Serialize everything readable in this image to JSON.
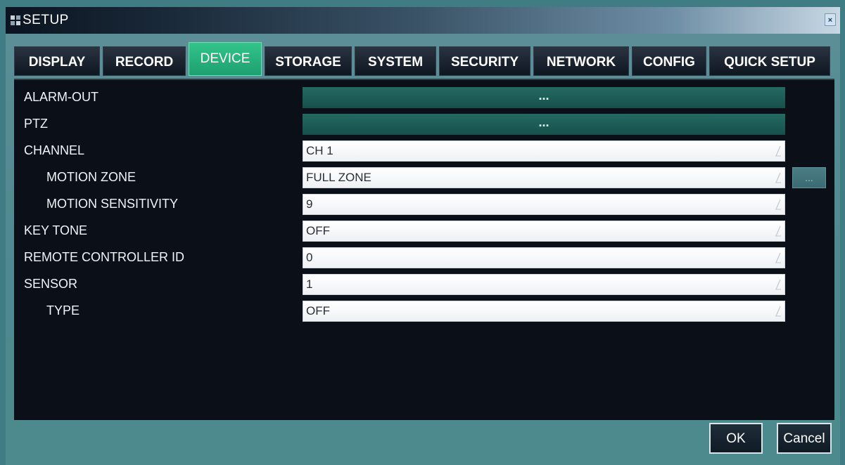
{
  "window": {
    "title": "SETUP",
    "close_label": "×"
  },
  "tabs": [
    {
      "label": "DISPLAY",
      "active": false
    },
    {
      "label": "RECORD",
      "active": false
    },
    {
      "label": "DEVICE",
      "active": true
    },
    {
      "label": "STORAGE",
      "active": false
    },
    {
      "label": "SYSTEM",
      "active": false
    },
    {
      "label": "SECURITY",
      "active": false
    },
    {
      "label": "NETWORK",
      "active": false
    },
    {
      "label": "CONFIG",
      "active": false
    },
    {
      "label": "QUICK SETUP",
      "active": false
    }
  ],
  "settings": {
    "alarm_out": {
      "label": "ALARM-OUT",
      "value": "..."
    },
    "ptz": {
      "label": "PTZ",
      "value": "..."
    },
    "channel": {
      "label": "CHANNEL",
      "value": "CH 1"
    },
    "motion_zone": {
      "label": "MOTION ZONE",
      "value": "FULL ZONE",
      "side_button": "..."
    },
    "motion_sensitivity": {
      "label": "MOTION SENSITIVITY",
      "value": "9"
    },
    "key_tone": {
      "label": "KEY TONE",
      "value": "OFF"
    },
    "remote_controller_id": {
      "label": "REMOTE CONTROLLER ID",
      "value": "0"
    },
    "sensor": {
      "label": "SENSOR",
      "value": "1"
    },
    "type": {
      "label": "TYPE",
      "value": "OFF"
    }
  },
  "footer": {
    "ok_label": "OK",
    "cancel_label": "Cancel"
  },
  "colors": {
    "active_tab": "#1da06f",
    "panel_bg": "#0b1018",
    "button_field": "#17504b"
  }
}
